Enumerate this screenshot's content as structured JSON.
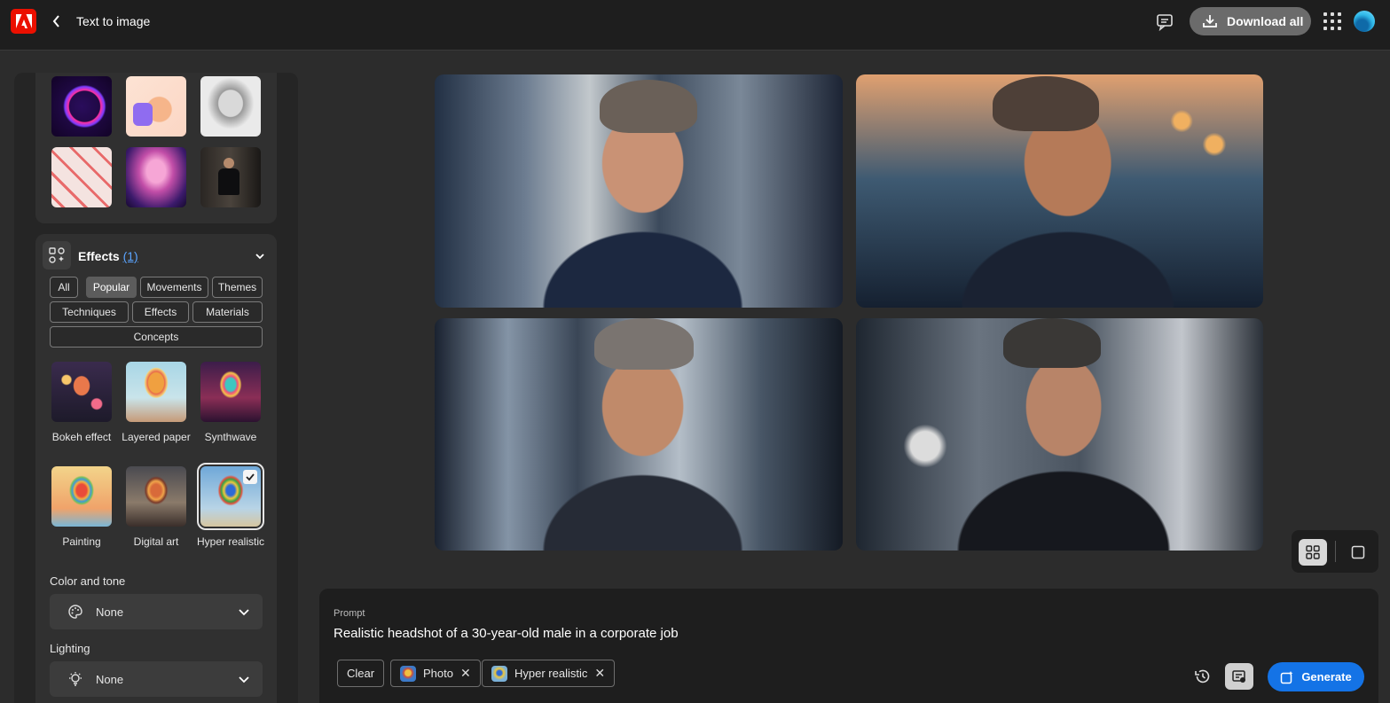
{
  "header": {
    "title": "Text to image",
    "download_label": "Download all"
  },
  "style_thumbnails": [
    "neon-figure",
    "thumbs-up-3d",
    "sketch-portrait",
    "pattern-art",
    "pink-clouds",
    "man-in-suit"
  ],
  "effects": {
    "title": "Effects",
    "count": "(1)",
    "filters": [
      "All",
      "Popular",
      "Movements",
      "Themes",
      "Techniques",
      "Effects",
      "Materials",
      "Concepts"
    ],
    "active_filter": "Popular",
    "items": [
      {
        "label": "Bokeh effect"
      },
      {
        "label": "Layered paper"
      },
      {
        "label": "Synthwave"
      },
      {
        "label": "Painting"
      },
      {
        "label": "Digital art"
      },
      {
        "label": "Hyper realistic",
        "selected": true
      }
    ]
  },
  "color_tone": {
    "label": "Color and tone",
    "value": "None"
  },
  "lighting": {
    "label": "Lighting",
    "value": "None"
  },
  "gallery": {
    "images": [
      "generated-headshot-1",
      "generated-headshot-2",
      "generated-headshot-3",
      "generated-headshot-4"
    ]
  },
  "prompt": {
    "label": "Prompt",
    "text": "Realistic headshot of a 30-year-old male in a corporate job",
    "clear_label": "Clear",
    "chips": [
      {
        "label": "Photo",
        "remove": "✕"
      },
      {
        "label": "Hyper realistic",
        "remove": "✕"
      }
    ],
    "generate_label": "Generate"
  },
  "colors": {
    "accent": "#1473e6",
    "brand": "#eb1000",
    "background": "#2c2c2c"
  }
}
